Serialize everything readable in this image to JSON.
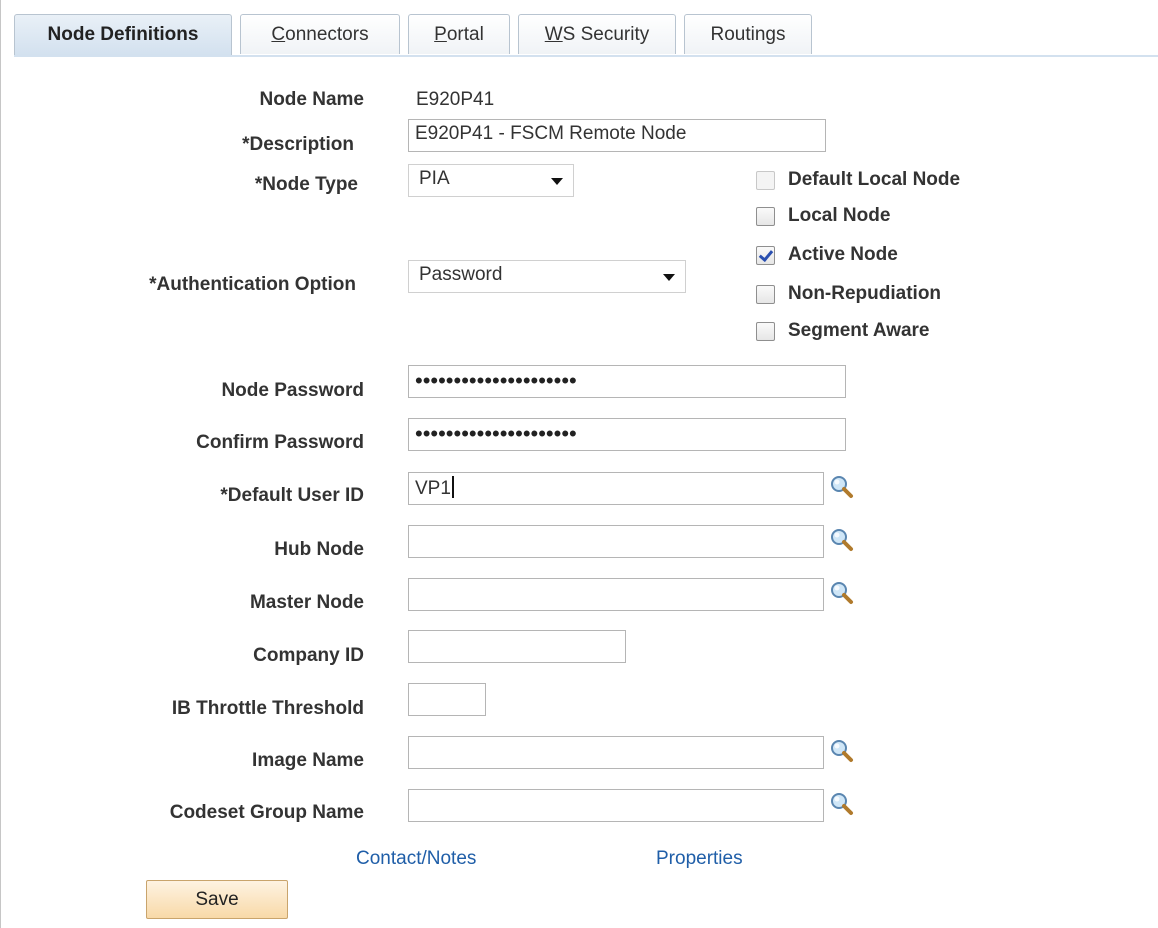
{
  "tabs": [
    {
      "label": "Node Definitions",
      "active": true
    },
    {
      "label": "Connectors",
      "mnemonic": "C",
      "rest": "onnectors"
    },
    {
      "label": "Portal",
      "mnemonic": "P",
      "rest": "ortal"
    },
    {
      "label": "WS Security",
      "mnemonic": "W",
      "rest": "S Security"
    },
    {
      "label": "Routings"
    }
  ],
  "form": {
    "node_name": {
      "label": "Node Name",
      "value": "E920P41"
    },
    "description": {
      "label": "*Description",
      "value": "E920P41 - FSCM Remote Node"
    },
    "node_type": {
      "label": "*Node Type",
      "value": "PIA"
    },
    "authentication_option": {
      "label": "*Authentication Option",
      "value": "Password"
    },
    "node_password": {
      "label": "Node Password",
      "value": "•••••••••••••••••••••"
    },
    "confirm_password": {
      "label": "Confirm Password",
      "value": "•••••••••••••••••••••"
    },
    "default_user_id": {
      "label": "*Default User ID",
      "value": "VP1"
    },
    "hub_node": {
      "label": "Hub Node",
      "value": ""
    },
    "master_node": {
      "label": "Master Node",
      "value": ""
    },
    "company_id": {
      "label": "Company ID",
      "value": ""
    },
    "ib_throttle_threshold": {
      "label": "IB Throttle Threshold",
      "value": ""
    },
    "image_name": {
      "label": "Image Name",
      "value": ""
    },
    "codeset_group_name": {
      "label": "Codeset Group Name",
      "value": ""
    }
  },
  "checkboxes": {
    "default_local_node": {
      "label": "Default Local Node",
      "checked": false,
      "disabled": true
    },
    "local_node": {
      "label": "Local Node",
      "checked": false
    },
    "active_node": {
      "label": "Active Node",
      "checked": true
    },
    "non_repudiation": {
      "label": "Non-Repudiation",
      "checked": false
    },
    "segment_aware": {
      "label": "Segment Aware",
      "checked": false
    }
  },
  "links": {
    "contact_notes": "Contact/Notes",
    "properties": "Properties"
  },
  "buttons": {
    "save": "Save"
  },
  "icons": {
    "lookup": "magnifier-lookup-icon",
    "dropdown": "chevron-down-icon",
    "checkmark": "checkmark-icon"
  },
  "colors": {
    "link": "#1f5ea8",
    "active_tab": "#d3e1ef",
    "save_button": "#f8d9a8",
    "label_text": "#333333"
  }
}
